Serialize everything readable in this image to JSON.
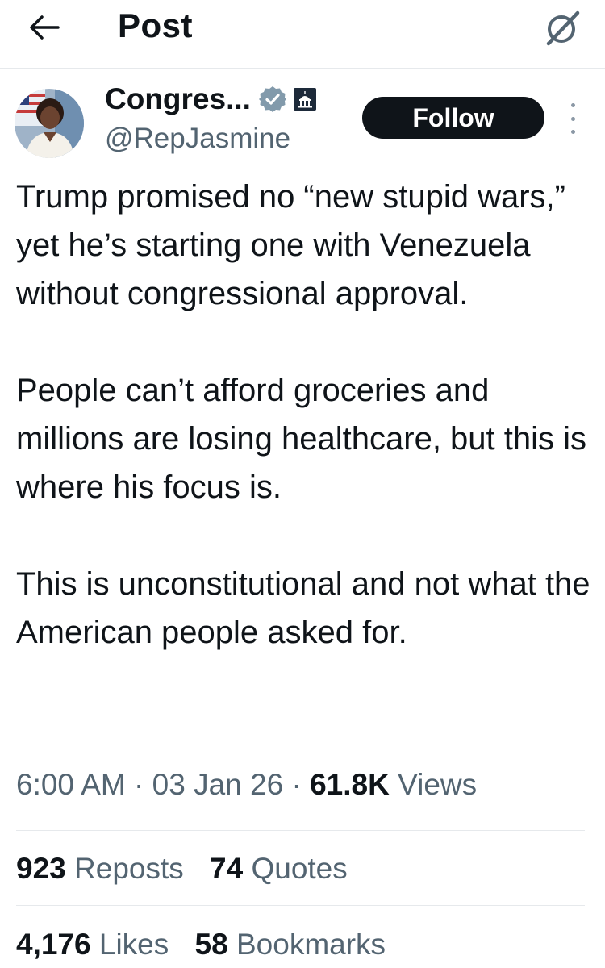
{
  "header": {
    "title": "Post",
    "back_icon": "arrow-left-icon",
    "grok_icon": "grok-icon"
  },
  "author": {
    "name": "Congres...",
    "handle": "@RepJasmine",
    "verified_icon": "verified-badge-icon",
    "affiliation_icon": "capitol-badge-icon",
    "follow_label": "Follow"
  },
  "post": {
    "paragraphs": [
      "Trump promised no “new stupid wars,” yet he’s starting one with Venezuela without congressional approval.",
      "People can’t afford groceries and millions are losing healthcare, but this is where his focus is.",
      "This is unconstitutional and not what the American people asked for."
    ]
  },
  "meta": {
    "time": "6:00 AM",
    "date": "03 Jan 26",
    "views_count": "61.8K",
    "views_label": "Views",
    "separator": "·"
  },
  "stats": {
    "reposts_count": "923",
    "reposts_label": "Reposts",
    "quotes_count": "74",
    "quotes_label": "Quotes",
    "likes_count": "4,176",
    "likes_label": "Likes",
    "bookmarks_count": "58",
    "bookmarks_label": "Bookmarks"
  },
  "colors": {
    "text": "#0f1419",
    "secondary": "#536471",
    "verified": "#829aab",
    "divider": "#e6e9ec"
  }
}
